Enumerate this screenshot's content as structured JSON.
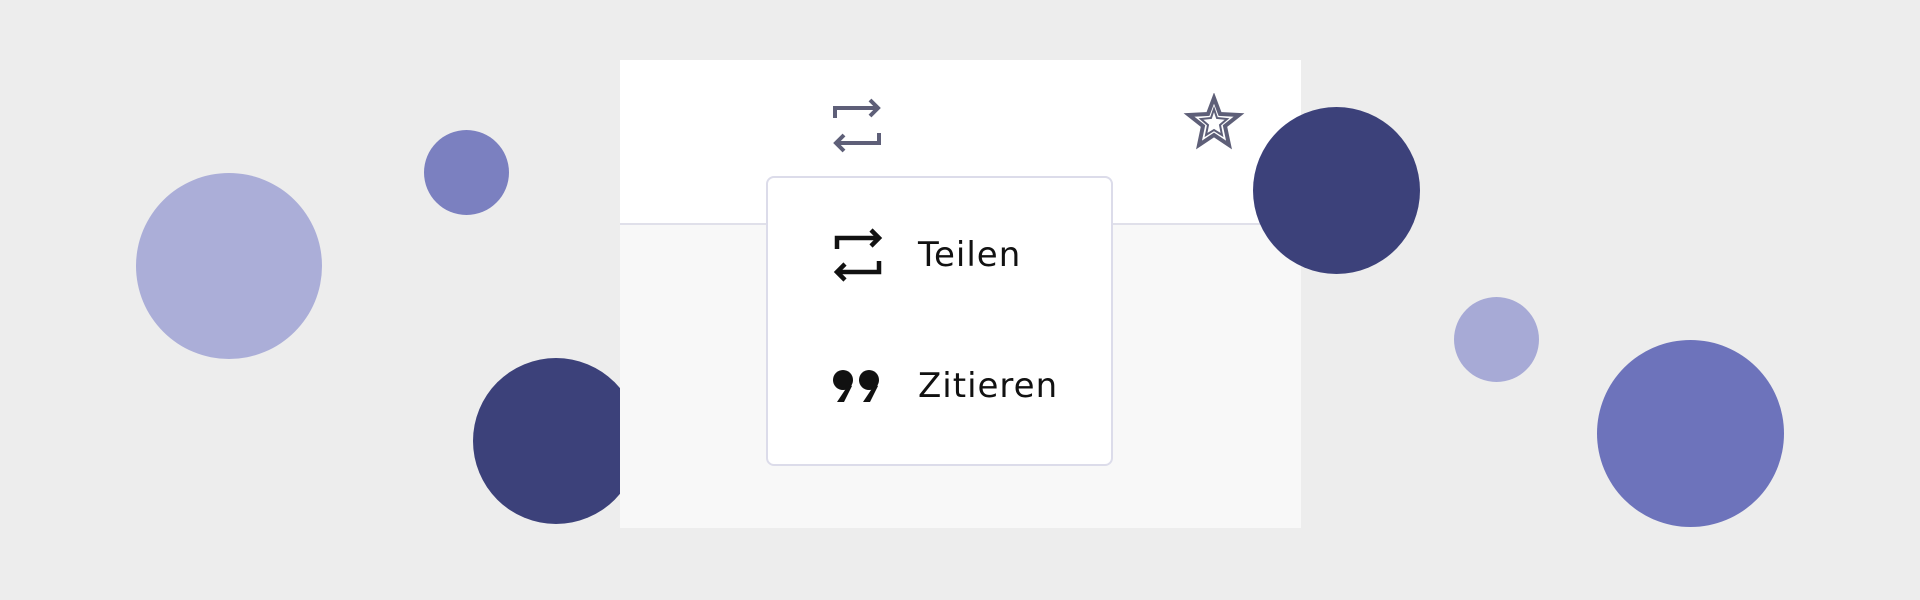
{
  "toolbar": {
    "icons": [
      "retweet-icon",
      "star-icon"
    ]
  },
  "menu": {
    "items": [
      {
        "label": "Teilen",
        "icon": "retweet-icon"
      },
      {
        "label": "Zitieren",
        "icon": "quote-icon"
      }
    ]
  },
  "colors": {
    "background": "#ededed",
    "card_top": "#ffffff",
    "card_body": "#f8f8f8",
    "icon_muted": "#5e5f78",
    "circle_dark": "#3c417a",
    "circle_mid": "#6d73bb",
    "circle_light": "#abaed8"
  }
}
